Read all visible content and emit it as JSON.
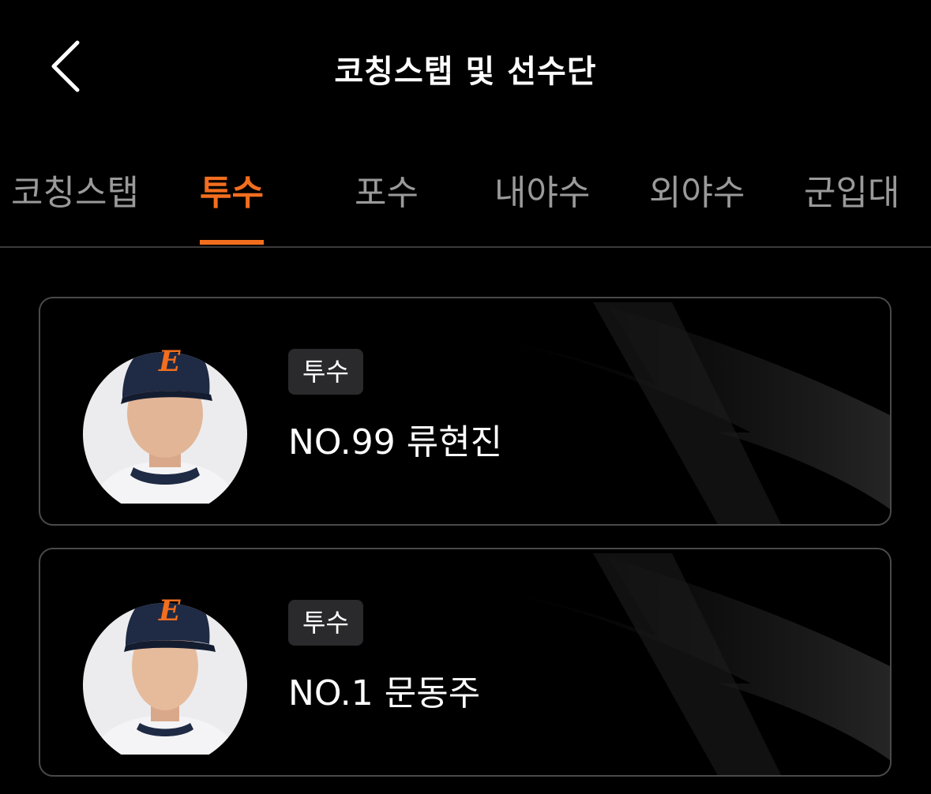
{
  "header": {
    "title": "코칭스탭 및 선수단",
    "back_icon": "chevron-left-icon"
  },
  "tabs": [
    {
      "label": "코칭스탭",
      "active": false
    },
    {
      "label": "투수",
      "active": true
    },
    {
      "label": "포수",
      "active": false
    },
    {
      "label": "내야수",
      "active": false
    },
    {
      "label": "외야수",
      "active": false
    },
    {
      "label": "군입대",
      "active": false
    }
  ],
  "players": [
    {
      "position": "투수",
      "name": "NO.99 류현진"
    },
    {
      "position": "투수",
      "name": "NO.1 문동주"
    }
  ],
  "colors": {
    "accent": "#f26e1e",
    "background": "#000000",
    "tab_inactive": "#9a9a9a",
    "card_border": "#4a4a4a",
    "badge_bg": "#2a2a2c",
    "cap": "#1f2a44"
  }
}
